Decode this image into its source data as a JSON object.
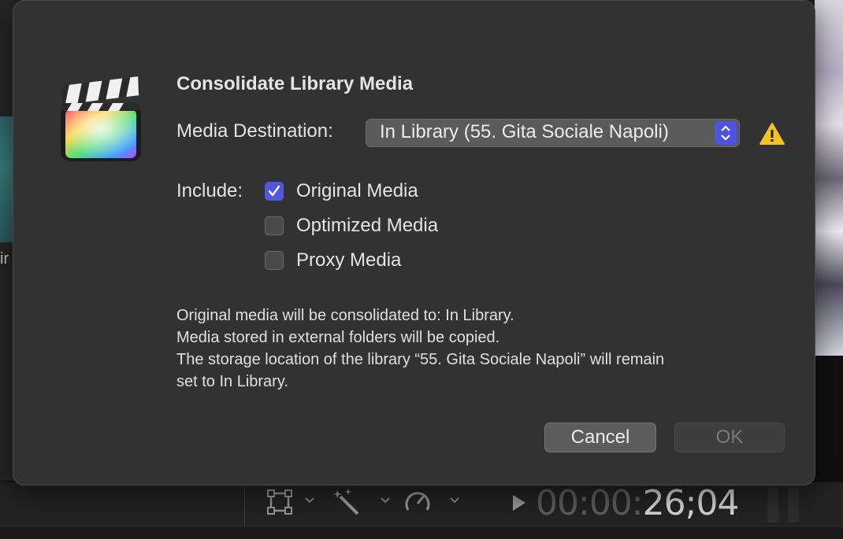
{
  "dialog": {
    "title": "Consolidate Library Media",
    "destination_label": "Media Destination:",
    "destination_value": "In Library (55. Gita Sociale Napoli)",
    "include_label": "Include:",
    "options": [
      {
        "label": "Original Media",
        "checked": true
      },
      {
        "label": "Optimized Media",
        "checked": false
      },
      {
        "label": "Proxy Media",
        "checked": false
      }
    ],
    "info_lines": [
      "Original media will be consolidated to: In Library.",
      "Media stored in external folders will be copied.",
      "The storage location of the library “55. Gita Sociale Napoli” will remain",
      "set to In Library."
    ],
    "cancel_label": "Cancel",
    "ok_label": "OK"
  },
  "background": {
    "thumb_text": "ir",
    "timecode_dim": "00:00:",
    "timecode_bright": "26;04"
  },
  "icons": {
    "app": "final-cut-pro-icon",
    "warning": "warning-triangle-icon",
    "checkmark": "checkmark-icon",
    "stepper": "up-down-chevron-icon"
  },
  "colors": {
    "dialog_bg": "#323232",
    "accent": "#5058dc",
    "warning": "#f2c322"
  }
}
